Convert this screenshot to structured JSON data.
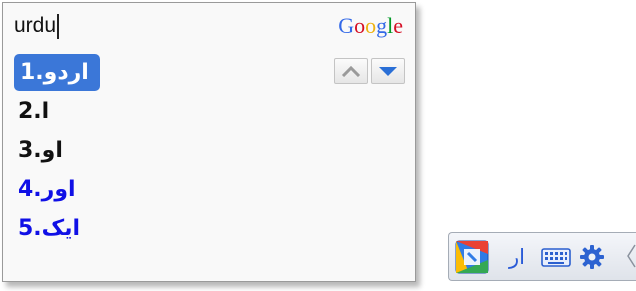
{
  "ime": {
    "composition_text": "urdu",
    "logo": {
      "letters": [
        "G",
        "o",
        "o",
        "g",
        "l",
        "e"
      ],
      "colors": [
        "#3369e8",
        "#d50f25",
        "#eeb211",
        "#3369e8",
        "#009925",
        "#d50f25"
      ]
    },
    "nav": {
      "prev_icon": "chevron-up-icon",
      "next_icon": "chevron-down-icon",
      "prev_color": "#9a9a9a",
      "next_color": "#2a6fd6"
    },
    "candidates": [
      {
        "number": "1.",
        "text": "اردو",
        "selected": true
      },
      {
        "number": "2.",
        "text": "ا",
        "selected": false
      },
      {
        "number": "3.",
        "text": "او",
        "selected": false
      },
      {
        "number": "4.",
        "text": "اور",
        "selected": false
      },
      {
        "number": "5.",
        "text": "ایک",
        "selected": false
      }
    ],
    "colors": {
      "selected_bg": "#3b77d8",
      "normal_text": "#111111",
      "blue_text": "#1010e6"
    }
  },
  "language_bar": {
    "ime_icon": "google-input-tools-icon",
    "language_indicator": "ار",
    "keyboard_icon": "keyboard-icon",
    "settings_icon": "gear-icon"
  }
}
